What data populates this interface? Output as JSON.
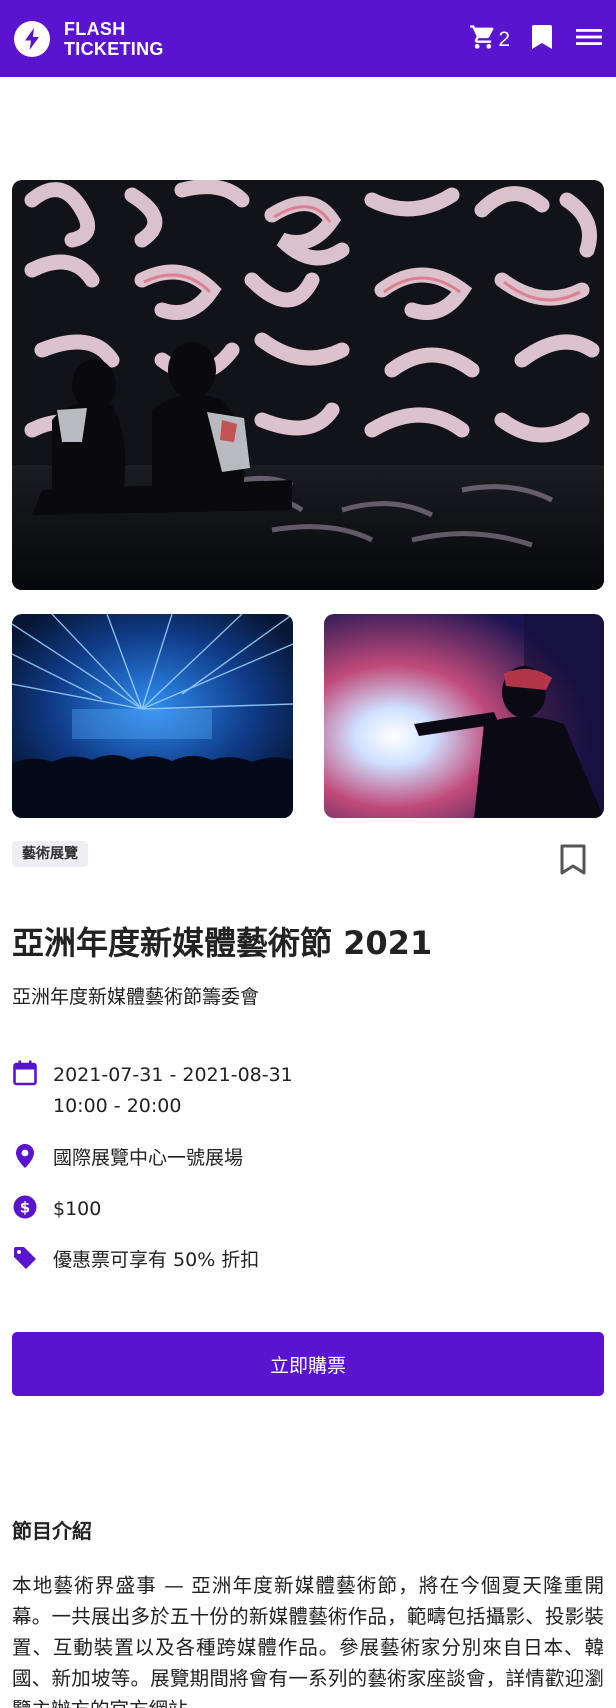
{
  "header": {
    "brand_line1": "FLASH",
    "brand_line2": "TICKETING",
    "cart_count": "2",
    "icons": [
      "lightning-logo-icon",
      "cart-icon",
      "bookmark-icon",
      "menu-icon"
    ],
    "bar_color": "#5a14cf"
  },
  "gallery": {
    "images": [
      {
        "name": "hero-image",
        "alt": "immersive projection art with figures seated on reflective floor"
      },
      {
        "name": "concert-laser-image",
        "alt": "blue laser show over concert crowd"
      },
      {
        "name": "performer-light-image",
        "alt": "performer silhouetted against beam of light"
      }
    ]
  },
  "event": {
    "category": "藝術展覽",
    "title": "亞洲年度新媒體藝術節 2021",
    "organizer": "亞洲年度新媒體藝術節籌委會",
    "date_range": "2021-07-31 - 2021-08-31",
    "time_range": "10:00 - 20:00",
    "venue": "國際展覽中心一號展場",
    "price": "$100",
    "discount": "優惠票可享有 50% 折扣",
    "buy_label": "立即購票"
  },
  "intro": {
    "heading": "節目介紹",
    "body": "本地藝術界盛事 — 亞洲年度新媒體藝術節，將在今個夏天隆重開幕。一共展出多於五十份的新媒體藝術作品，範疇包括攝影、投影裝置、互動裝置以及各種跨媒體作品。參展藝術家分別來自日本、韓國、新加坡等。展覽期間將會有一系列的藝術家座談會，詳情歡迎瀏覽主辦方的官方網站。"
  },
  "colors": {
    "accent": "#5a14cf",
    "category_bg": "#efeef3",
    "text": "#222222"
  }
}
